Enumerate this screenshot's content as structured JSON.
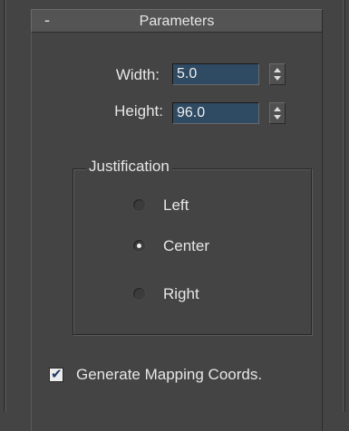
{
  "rollout": {
    "collapse_symbol": "-",
    "title": "Parameters"
  },
  "fields": {
    "width": {
      "label": "Width:",
      "value": "5.0"
    },
    "height": {
      "label": "Height:",
      "value": "96.0"
    }
  },
  "justification": {
    "title": "Justification",
    "options": [
      {
        "label": "Left",
        "checked": false
      },
      {
        "label": "Center",
        "checked": true
      },
      {
        "label": "Right",
        "checked": false
      }
    ]
  },
  "mapping": {
    "label": "Generate Mapping Coords.",
    "checked": true,
    "check_glyph": "✔"
  },
  "colors": {
    "panel_bg": "#444444",
    "input_bg": "#2f4a63",
    "text": "#e6e6e6"
  },
  "icons": [
    "spinner-up-icon",
    "spinner-down-icon",
    "radio-icon",
    "checkmark-icon"
  ]
}
